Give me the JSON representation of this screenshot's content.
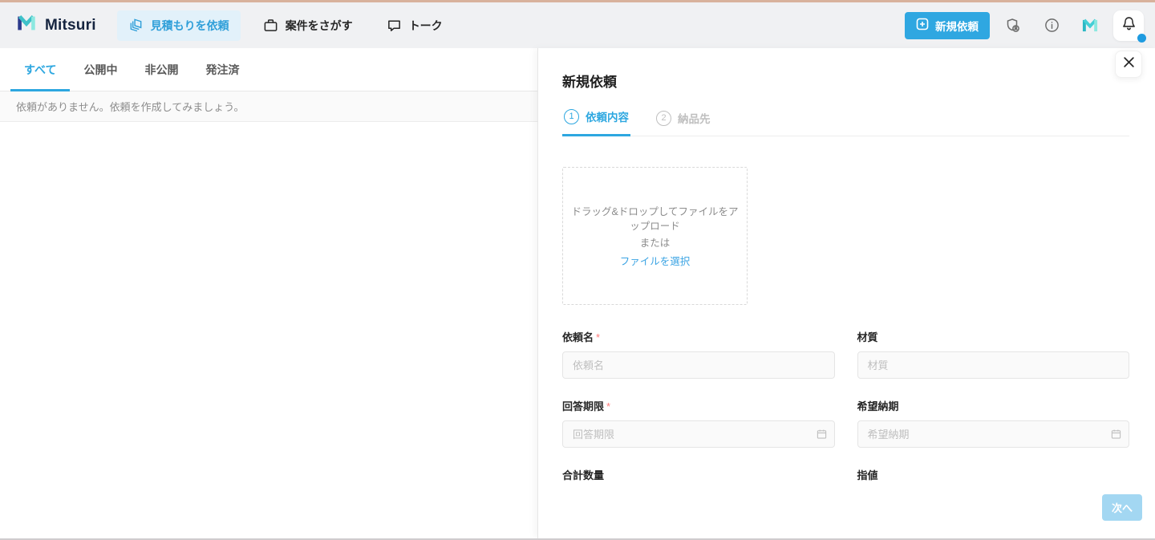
{
  "topbar": {
    "brand": "Mitsuri",
    "nav": [
      {
        "label": "見積もりを依頼",
        "active": true
      },
      {
        "label": "案件をさがす",
        "active": false
      },
      {
        "label": "トーク",
        "active": false
      }
    ],
    "new_request_button": "新規依頼"
  },
  "list": {
    "tabs": [
      "すべて",
      "公開中",
      "非公開",
      "発注済"
    ],
    "empty_message": "依頼がありません。依頼を作成してみましょう。"
  },
  "drawer": {
    "title": "新規依頼",
    "steps": [
      {
        "number": "1",
        "label": "依頼内容",
        "active": true
      },
      {
        "number": "2",
        "label": "納品先",
        "active": false
      }
    ],
    "upload": {
      "line1": "ドラッグ&ドロップしてファイルをアップロード",
      "line2": "または",
      "link": "ファイルを選択"
    },
    "fields": [
      {
        "label": "依頼名",
        "required_mark": "*",
        "placeholder": "依頼名"
      },
      {
        "label": "材質",
        "placeholder": "材質"
      },
      {
        "label": "回答期限",
        "required_mark": "*",
        "placeholder": "回答期限"
      },
      {
        "label": "希望納期",
        "placeholder": "希望納期"
      },
      {
        "label": "合計数量",
        "placeholder": ""
      },
      {
        "label": "指値",
        "placeholder": ""
      }
    ],
    "next_button": "次へ"
  },
  "icons": {
    "brand_logo": "mitsuri-m-logo",
    "nav": [
      "layers-icon",
      "briefcase-icon",
      "chat-bubble-icon"
    ],
    "right": [
      "plus-square-icon",
      "shield-badge-icon",
      "info-icon",
      "mitsuri-avatar",
      "bell-icon"
    ],
    "drawer": [
      "close-icon",
      "calendar-icon"
    ]
  },
  "colors": {
    "accent_blue": "#2fa7e1",
    "active_tab_blue": "#2da7e0",
    "disabled_button_blue": "#a3d7f2",
    "top_strip": "#d8b29c",
    "navbar_bg": "#f0f1f3",
    "required_red": "#ff7a7a",
    "link_blue": "#3aa3e3",
    "notification_dot": "#1e9be0"
  }
}
